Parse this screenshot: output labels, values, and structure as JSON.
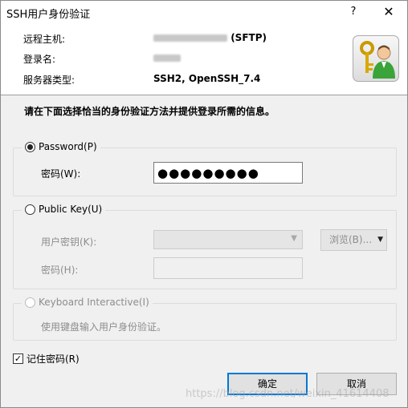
{
  "window": {
    "title": "SSH用户身份验证",
    "help": "?",
    "close": "✕"
  },
  "header": {
    "remote_host_label": "远程主机:",
    "remote_host_value": "(SFTP)",
    "login_name_label": "登录名:",
    "server_type_label": "服务器类型:",
    "server_type_value": "SSH2, OpenSSH_7.4",
    "icon": "key-user-icon"
  },
  "instruction": "请在下面选择恰当的身份验证方法并提供登录所需的信息。",
  "password_group": {
    "label": "Password(P)",
    "selected": true,
    "password_label": "密码(W):",
    "password_value": "●●●●●●●●●"
  },
  "public_key_group": {
    "label": "Public Key(U)",
    "selected": false,
    "user_key_label": "用户密钥(K):",
    "browse_label": "浏览(B)...",
    "passphrase_label": "密码(H):"
  },
  "keyboard_group": {
    "label": "Keyboard Interactive(I)",
    "selected": false,
    "description": "使用键盘输入用户身份验证。"
  },
  "remember_password": {
    "label": "记住密码(R)",
    "checked": true
  },
  "buttons": {
    "ok": "确定",
    "cancel": "取消"
  },
  "watermark": "https://blog.csdn.net/weixin_41614408"
}
